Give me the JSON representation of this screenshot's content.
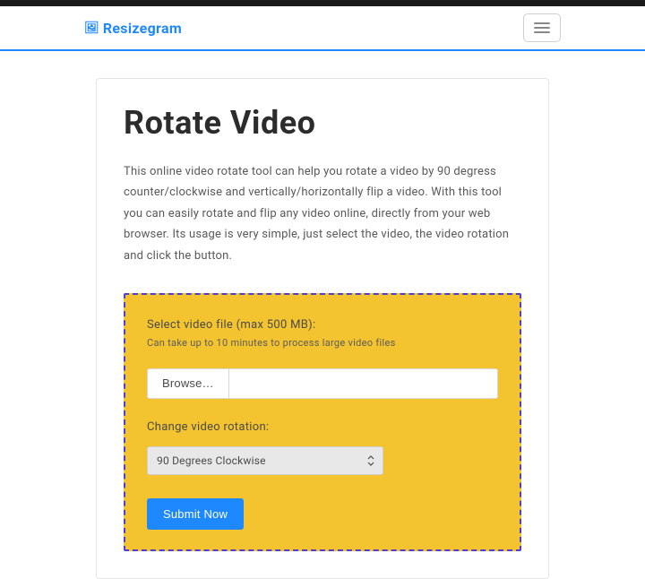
{
  "brand": {
    "icon_glyph": "🖼",
    "name": "Resizegram"
  },
  "page": {
    "title": "Rotate Video",
    "description": "This online video rotate tool can help you rotate a video by 90 degress counter/clockwise and vertically/horizontally flip a video. With this tool you can easily rotate and flip any video online, directly from your web browser. Its usage is very simple, just select the video, the video rotation and click the button."
  },
  "form": {
    "select_file_label": "Select video file (max 500 MB):",
    "select_file_hint": "Can take up to 10 minutes to process large video files",
    "browse_label": "Browse…",
    "file_name": "",
    "rotation_label": "Change video rotation:",
    "rotation_selected": "90 Degrees Clockwise",
    "submit_label": "Submit Now"
  }
}
